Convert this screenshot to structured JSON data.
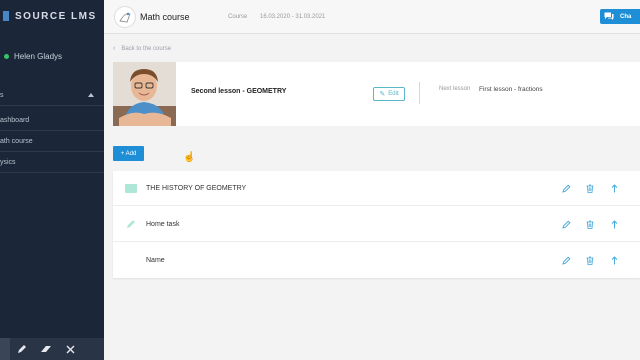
{
  "brand": {
    "name": "SOURCE LMS"
  },
  "user": {
    "name": "Helen Gladys"
  },
  "sidebar": {
    "section_label": "s",
    "items": [
      {
        "label": "ashboard"
      },
      {
        "label": "ath course"
      },
      {
        "label": "ysics"
      }
    ]
  },
  "topbar": {
    "course_title": "Math course",
    "course_label": "Course",
    "course_dates": "16.03.2020 - 31.03.2021",
    "chat_label": "Cha"
  },
  "back_link": "Back to the course",
  "lesson": {
    "title": "Second lesson - GEOMETRY",
    "edit_label": "Edit",
    "next_label": "Next lesson",
    "next_value": "First lesson - fractions"
  },
  "add_label": "+ Add",
  "items": [
    {
      "label": "THE HISTORY OF GEOMETRY",
      "icon": "folder-icon"
    },
    {
      "label": "Home task",
      "icon": "pencil-icon"
    },
    {
      "label": "Name",
      "icon": ""
    }
  ],
  "colors": {
    "sidebar_bg": "#1b2638",
    "accent": "#1e8fd6",
    "action_icon": "#3aa3d9",
    "online": "#35c46b"
  }
}
